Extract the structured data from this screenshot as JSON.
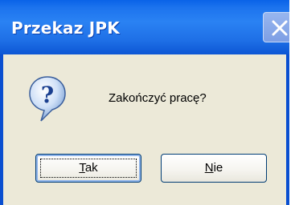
{
  "dialog": {
    "title": "Przekaz JPK",
    "message": "Zakończyć pracę?",
    "icon": "question-icon",
    "close_icon": "close-icon"
  },
  "buttons": {
    "yes": {
      "mnemonic": "T",
      "rest": "ak",
      "label": "Tak"
    },
    "no": {
      "mnemonic": "N",
      "rest": "ie",
      "label": "Nie"
    }
  },
  "colors": {
    "titlebar": "#0a63e8",
    "dialog_bg": "#ece9d8",
    "button_border": "#003c74"
  }
}
